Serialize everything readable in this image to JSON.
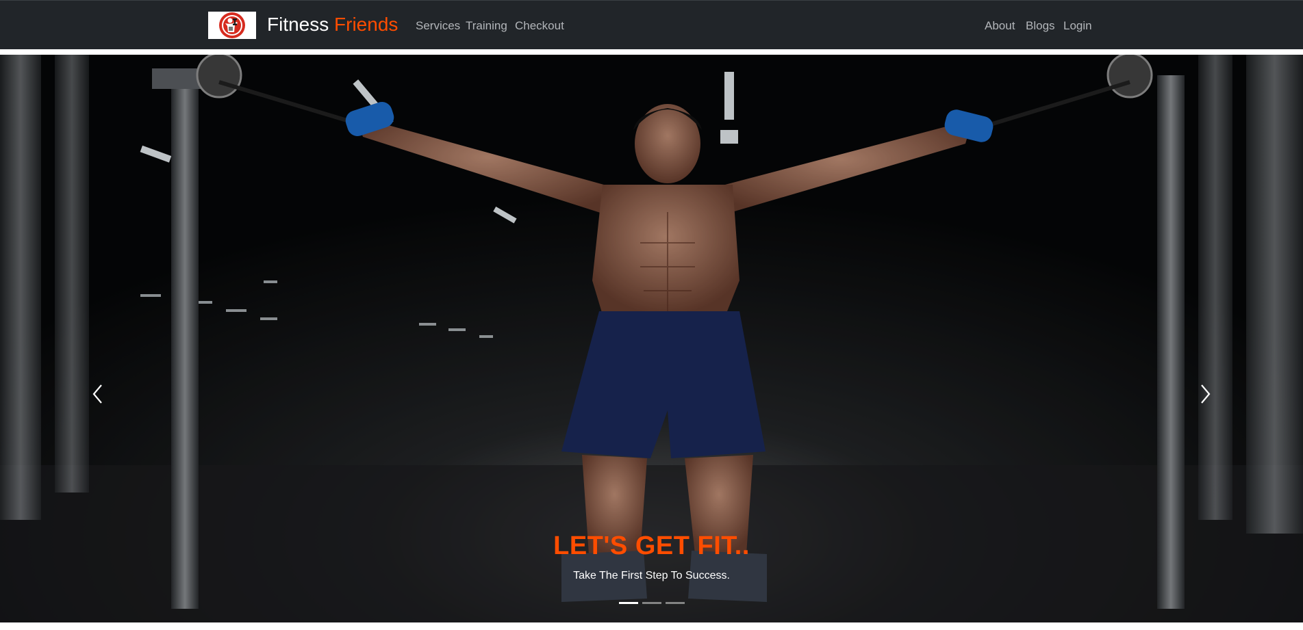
{
  "brand": {
    "name_part1": "Fitness",
    "name_part2": "Friends",
    "logo_icon": "bodybuilder-logo-icon",
    "accent_color": "#ff4d00"
  },
  "nav": {
    "left_links": [
      "Services",
      "Training",
      "Checkout"
    ],
    "right_links": [
      "About",
      "Blogs",
      "Login"
    ],
    "bar_color": "#212529"
  },
  "hero": {
    "image": "man-training-cable-machine-gym",
    "title": "LET'S GET FIT..",
    "subtitle": "Take The First Step To Success.",
    "prev_icon": "chevron-left-icon",
    "next_icon": "chevron-right-icon",
    "slide_count": 3,
    "active_slide": 1
  }
}
